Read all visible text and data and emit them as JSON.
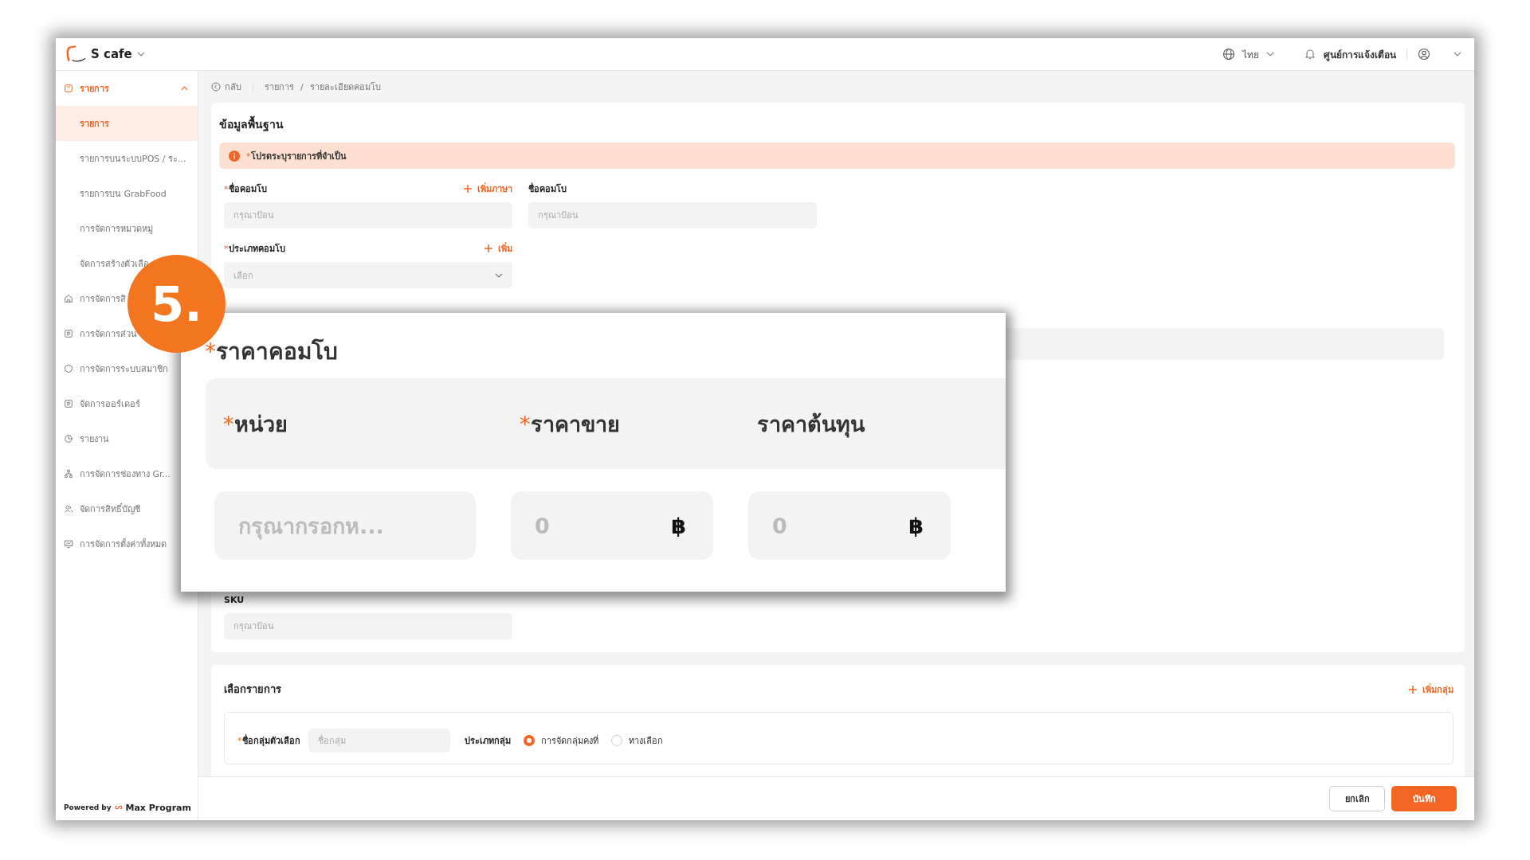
{
  "header": {
    "shop_name": "S cafe",
    "language": "ไทย",
    "notifications": "ศูนย์การแจ้งเตือน"
  },
  "sidebar": {
    "groups": [
      {
        "label": "รายการ",
        "expanded": true,
        "children": [
          {
            "label": "รายการ",
            "selected": true
          },
          {
            "label": "รายการบนระบบPOS / ระ...",
            "selected": false
          },
          {
            "label": "รายการบน GrabFood",
            "selected": false
          },
          {
            "label": "การจัดการหมวดหมู่",
            "selected": false
          },
          {
            "label": "จัดการสร้างตัวเลือ",
            "selected": false
          }
        ]
      },
      {
        "label": "การจัดการสิ"
      },
      {
        "label": "การจัดการส่วน"
      },
      {
        "label": "การจัดการระบบสมาชิก"
      },
      {
        "label": "จัดการออร์เดอร์"
      },
      {
        "label": "รายงาน"
      },
      {
        "label": "การจัดการช่องทาง Gr..."
      },
      {
        "label": "จัดการสิทธิ์บัญชี"
      },
      {
        "label": "การจัดการตั้งค่าทั้งหมด"
      }
    ],
    "powered_by": "Powered by",
    "brand": "Max Program"
  },
  "breadcrumb": {
    "back": "กลับ",
    "separator": "/",
    "items": [
      "รายการ",
      "รายละเอียดคอมโบ"
    ]
  },
  "basic_info": {
    "title": "ข้อมูลพื้นฐาน",
    "alert": {
      "mark": "*",
      "text": "โปรดระบุรายการที่จำเป็น"
    },
    "name_field": {
      "mark": "*",
      "label": "ชื่อคอมโบ",
      "action": "เพิ่มภาษา",
      "placeholder": "กรุณาป้อน"
    },
    "name_field_2": {
      "label": "ชื่อคอมโบ",
      "placeholder": "กรุณาป้อน"
    },
    "type_field": {
      "mark": "*",
      "label": "ประเภทคอมโบ",
      "action": "เพิ่ม",
      "placeholder": "เลือก"
    },
    "sku_field": {
      "label": "SKU",
      "placeholder": "กรุณาป้อน"
    }
  },
  "options": {
    "title": "เลือกรายการ",
    "action": "เพิ่มกลุ่ม",
    "group_name": {
      "mark": "*",
      "label": "ชื่อกลุ่มตัวเลือก",
      "placeholder": "ชื่อกลุ่ม"
    },
    "group_type": {
      "label": "ประเภทกลุ่ม",
      "choices": [
        {
          "label": "การจัดกลุ่มคงที่",
          "selected": true
        },
        {
          "label": "ทางเลือก",
          "selected": false
        }
      ]
    }
  },
  "footer": {
    "buttons": [
      {
        "label": "ยกเลิก",
        "kind": "secondary"
      },
      {
        "label": "บันทึก",
        "kind": "primary"
      }
    ]
  },
  "callout": {
    "step": "5.",
    "title": {
      "mark": "*",
      "text": "ราคาคอมโบ"
    },
    "columns": [
      {
        "mark": "*",
        "text": "หน่วย"
      },
      {
        "mark": "*",
        "text": "ราคาขาย"
      },
      {
        "text": "ราคาต้นทุน"
      }
    ],
    "inputs": [
      {
        "placeholder": "กรุณากรอกห..."
      },
      {
        "placeholder": "0",
        "suffix": "฿"
      },
      {
        "placeholder": "0",
        "suffix": "฿"
      }
    ]
  }
}
